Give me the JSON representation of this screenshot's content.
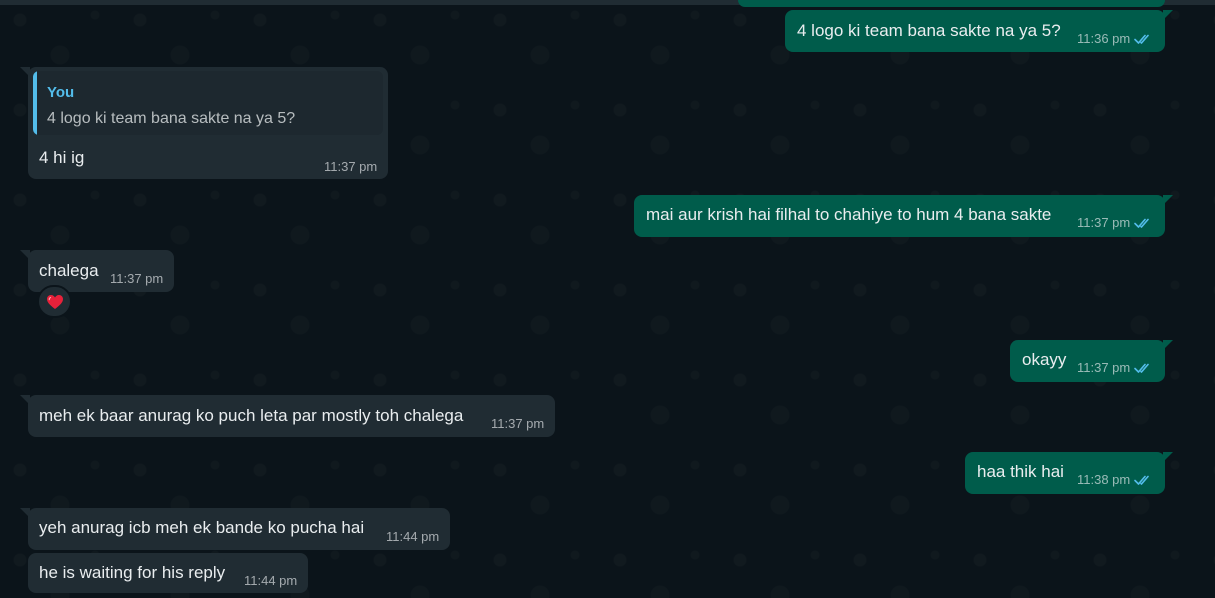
{
  "conversation": {
    "messages": [
      {
        "direction": "outgoing",
        "text": "4 logo ki team bana sakte na ya 5?",
        "time": "11:36 pm",
        "status_icon": "double-check-icon"
      },
      {
        "direction": "incoming",
        "quote": {
          "author": "You",
          "text": "4 logo ki team bana sakte na ya 5?"
        },
        "text": "4 hi ig",
        "time": "11:37 pm"
      },
      {
        "direction": "outgoing",
        "text": "mai aur krish hai filhal to chahiye to hum 4 bana sakte",
        "time": "11:37 pm",
        "status_icon": "double-check-icon"
      },
      {
        "direction": "incoming",
        "text": "chalega",
        "time": "11:37 pm",
        "reaction": "❤️"
      },
      {
        "direction": "outgoing",
        "text": "okayy",
        "time": "11:37 pm",
        "status_icon": "double-check-icon"
      },
      {
        "direction": "incoming",
        "text": "meh ek baar anurag ko puch leta par mostly toh chalega",
        "time": "11:37 pm"
      },
      {
        "direction": "outgoing",
        "text": "haa thik hai",
        "time": "11:38 pm",
        "status_icon": "double-check-icon"
      },
      {
        "direction": "incoming",
        "text": "yeh anurag icb meh ek bande ko pucha hai",
        "time": "11:44 pm"
      },
      {
        "direction": "incoming",
        "text": "he is waiting for his reply",
        "time": "11:44 pm"
      }
    ]
  },
  "colors": {
    "background": "#0b141a",
    "outgoing_bubble": "#005c4b",
    "incoming_bubble": "#202c33",
    "read_ticks": "#53bdeb",
    "quote_accent": "#53bdeb"
  }
}
